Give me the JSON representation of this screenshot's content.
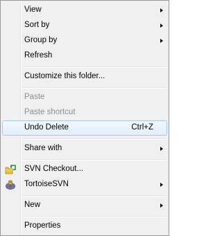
{
  "menu": {
    "items": [
      {
        "label": "View",
        "submenu": true
      },
      {
        "label": "Sort by",
        "submenu": true
      },
      {
        "label": "Group by",
        "submenu": true
      },
      {
        "label": "Refresh"
      },
      {
        "label": "Customize this folder..."
      },
      {
        "label": "Paste",
        "disabled": true
      },
      {
        "label": "Paste shortcut",
        "disabled": true
      },
      {
        "label": "Undo Delete",
        "shortcut": "Ctrl+Z",
        "highlighted": true
      },
      {
        "label": "Share with",
        "submenu": true
      },
      {
        "label": "SVN Checkout...",
        "icon": "svn-checkout-icon"
      },
      {
        "label": "TortoiseSVN",
        "icon": "tortoisesvn-icon",
        "submenu": true
      },
      {
        "label": "New",
        "submenu": true
      },
      {
        "label": "Properties"
      }
    ]
  }
}
